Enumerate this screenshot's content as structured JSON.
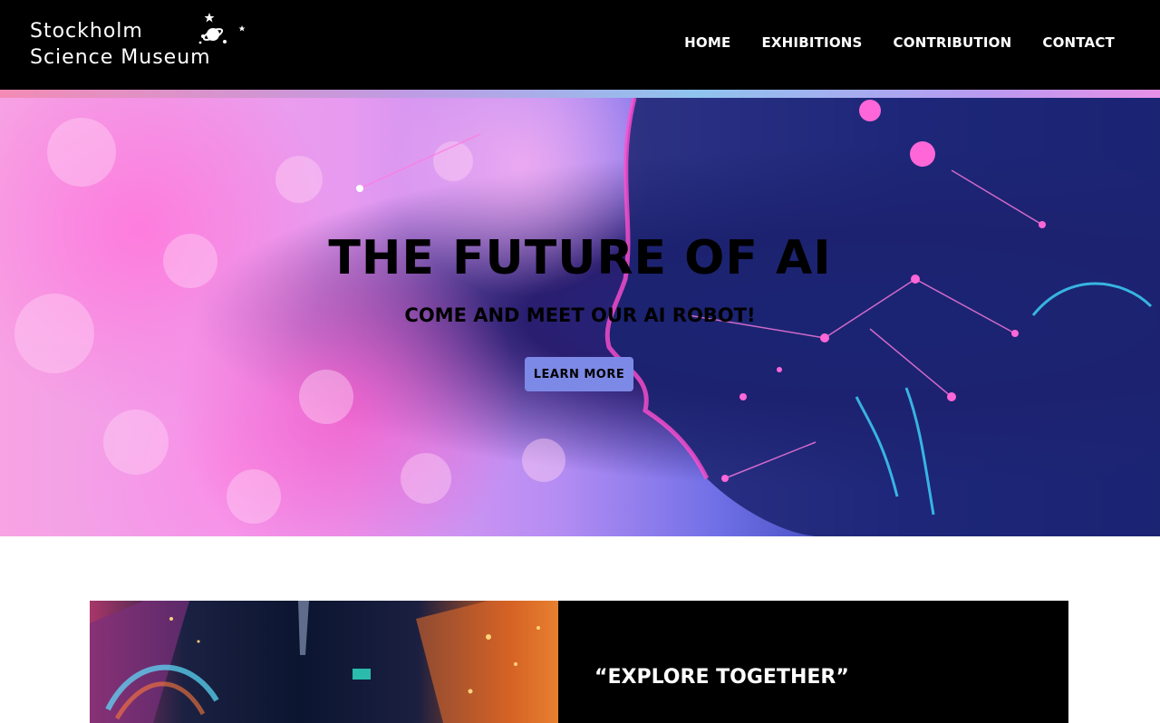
{
  "header": {
    "logo_line1": "Stockholm",
    "logo_line2": "Science Museum",
    "nav": [
      "HOME",
      "EXHIBITIONS",
      "CONTRIBUTION",
      "CONTACT"
    ]
  },
  "hero": {
    "title": "THE FUTURE OF AI",
    "subtitle": "COME AND MEET OUR AI ROBOT!",
    "button_label": "LEARN MORE"
  },
  "feature": {
    "title": "“EXPLORE TOGETHER”"
  },
  "colors": {
    "header_bg": "#000000",
    "button_bg": "#7d89e6",
    "panel_bg": "#000000"
  }
}
